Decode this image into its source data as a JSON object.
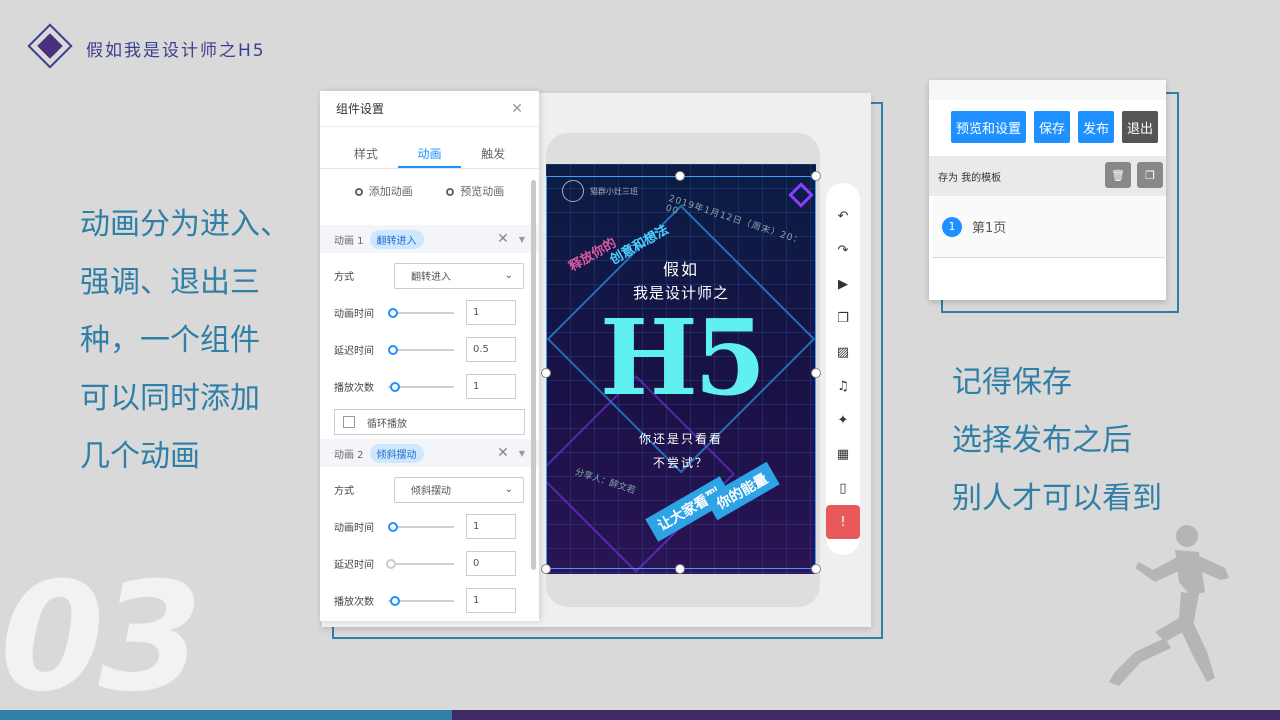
{
  "header": {
    "title": "假如我是设计师之H5"
  },
  "left_text": [
    "动画分为进入、",
    "强调、退出三",
    "种，一个组件",
    "可以同时添加",
    "几个动画"
  ],
  "right_text": [
    "记得保存",
    "选择发布之后",
    "别人才可以看到"
  ],
  "section_number": "03",
  "colors": {
    "accent": "#2f7fa6",
    "purple": "#3f2a66",
    "primary_button": "#1e90ff"
  },
  "panel": {
    "title": "组件设置",
    "tabs": [
      {
        "label": "样式",
        "active": false
      },
      {
        "label": "动画",
        "active": true
      },
      {
        "label": "触发",
        "active": false
      }
    ],
    "add_label": "添加动画",
    "preview_label": "预览动画",
    "anim1": {
      "title": "动画 1",
      "chip": "翻转进入",
      "method_label": "方式",
      "method_value": "翻转进入",
      "duration_label": "动画时间",
      "duration_value": "1",
      "delay_label": "延迟时间",
      "delay_value": "0.5",
      "count_label": "播放次数",
      "count_value": "1",
      "loop_label": "循环播放"
    },
    "anim2": {
      "title": "动画 2",
      "chip": "倾斜摆动",
      "method_label": "方式",
      "method_value": "倾斜摆动",
      "duration_label": "动画时间",
      "duration_value": "1",
      "delay_label": "延迟时间",
      "delay_value": "0",
      "count_label": "播放次数",
      "count_value": "1"
    }
  },
  "poster": {
    "brand": "猫群小灶三班",
    "date": "2019年1月12日（周末）20：00",
    "slant1": "释放你的",
    "slant2": "创意和想法",
    "line1": "假如",
    "line2": "我是设计师之",
    "big": "H5",
    "line3": "你还是只看看",
    "line4": "不尝试？",
    "sharer": "分享人：醉文若",
    "banner1": "让大家看到",
    "banner2": "你的能量"
  },
  "toolbar": {
    "icons": [
      "undo-icon",
      "redo-icon",
      "play-icon",
      "copy-icon",
      "texture-icon",
      "music-icon",
      "sparkle-icon",
      "grid-icon",
      "phone-icon",
      "alert-icon"
    ]
  },
  "right_panel": {
    "buttons": [
      "预览和设置",
      "保存",
      "发布",
      "退出"
    ],
    "template_label": "存为  我的模板",
    "page_number": "1",
    "page_label": "第1页"
  }
}
